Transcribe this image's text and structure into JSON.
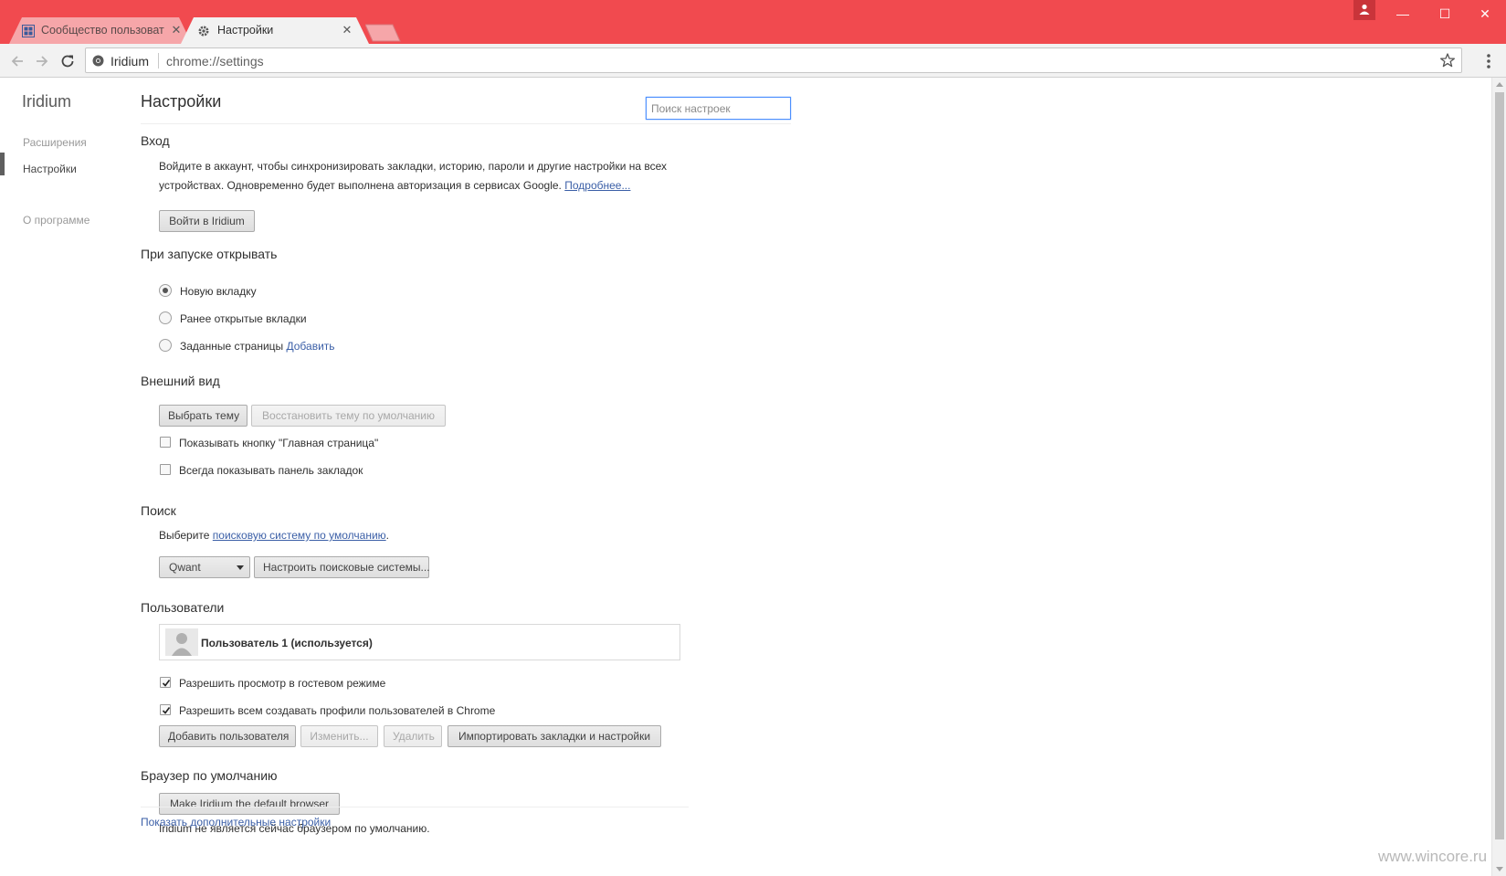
{
  "tabs": [
    {
      "title": "Сообщество пользоват",
      "icon": "grid-icon"
    },
    {
      "title": "Настройки",
      "icon": "gear-icon"
    }
  ],
  "toolbar": {
    "origin": "Iridium",
    "url": "chrome://settings"
  },
  "sidebar": {
    "title": "Iridium",
    "items": [
      {
        "label": "Расширения"
      },
      {
        "label": "Настройки"
      },
      {
        "label": "О программе"
      }
    ]
  },
  "page": {
    "title": "Настройки",
    "search_placeholder": "Поиск настроек"
  },
  "signin": {
    "title": "Вход",
    "desc_line1": "Войдите в аккаунт, чтобы синхронизировать закладки, историю, пароли и другие настройки на всех",
    "desc_line2": "устройствах. Одновременно будет выполнена авторизация в сервисах Google.",
    "more_link": "Подробнее...",
    "button": "Войти в Iridium"
  },
  "startup": {
    "title": "При запуске открывать",
    "options": [
      {
        "label": "Новую вкладку",
        "checked": true
      },
      {
        "label": "Ранее открытые вкладки",
        "checked": false
      },
      {
        "label": "Заданные страницы",
        "checked": false
      }
    ],
    "add_link": "Добавить"
  },
  "appearance": {
    "title": "Внешний вид",
    "choose_theme": "Выбрать тему",
    "reset_theme": "Восстановить тему по умолчанию",
    "show_home": "Показывать кнопку \"Главная страница\"",
    "show_bookmarks": "Всегда показывать панель закладок"
  },
  "search": {
    "title": "Поиск",
    "prefix": "Выберите",
    "link": "поисковую систему по умолчанию",
    "suffix": ".",
    "engine": "Qwant",
    "manage": "Настроить поисковые системы..."
  },
  "users": {
    "title": "Пользователи",
    "current": "Пользователь 1 (используется)",
    "guest": "Разрешить просмотр в гостевом режиме",
    "anyone": "Разрешить всем создавать профили пользователей в Chrome",
    "add": "Добавить пользователя",
    "edit": "Изменить...",
    "delete": "Удалить",
    "import": "Импортировать закладки и настройки"
  },
  "default_browser": {
    "title": "Браузер по умолчанию",
    "button": "Make Iridium the default browser",
    "status": "Iridium не является сейчас браузером по умолчанию."
  },
  "advanced_link": "Показать дополнительные настройки",
  "watermark": "www.wincore.ru",
  "colors": {
    "titlebar": "#f14a4f",
    "link": "#3b5fa7"
  }
}
